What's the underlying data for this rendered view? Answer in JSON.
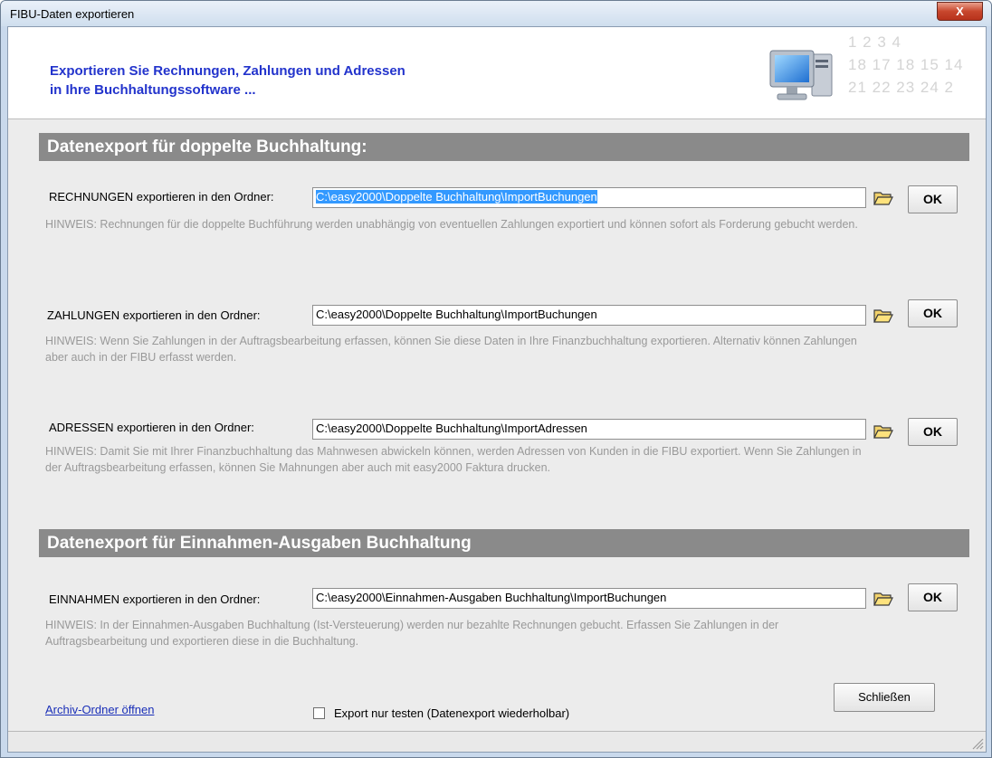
{
  "window": {
    "title": "FIBU-Daten exportieren",
    "close_glyph": "X"
  },
  "banner": {
    "line1": "Exportieren Sie Rechnungen, Zahlungen und Adressen",
    "line2": "in Ihre Buchhaltungssoftware ...",
    "calendar_row1": "1  2  3  4",
    "calendar_row2": "18 17 18 15 14",
    "calendar_row3": "21 22 23 24 2"
  },
  "sections": {
    "double": "Datenexport für doppelte Buchhaltung:",
    "income": "Datenexport für Einnahmen-Ausgaben Buchhaltung"
  },
  "rows": {
    "rechnungen": {
      "label": "RECHNUNGEN exportieren in den Ordner:",
      "path": "C:\\easy2000\\Doppelte Buchhaltung\\ImportBuchungen",
      "ok": "OK",
      "hint": "HINWEIS: Rechnungen für die doppelte Buchführung werden unabhängig von eventuellen Zahlungen exportiert und können sofort als Forderung gebucht werden."
    },
    "zahlungen": {
      "label": "ZAHLUNGEN exportieren in den Ordner:",
      "path": "C:\\easy2000\\Doppelte Buchhaltung\\ImportBuchungen",
      "ok": "OK",
      "hint": "HINWEIS: Wenn Sie Zahlungen in der Auftragsbearbeitung erfassen, können Sie diese Daten in Ihre Finanzbuchhaltung exportieren. Alternativ können Zahlungen aber auch in der FIBU erfasst werden."
    },
    "adressen": {
      "label": "ADRESSEN exportieren in den Ordner:",
      "path": "C:\\easy2000\\Doppelte Buchhaltung\\ImportAdressen",
      "ok": "OK",
      "hint": "HINWEIS: Damit Sie mit Ihrer Finanzbuchhaltung das Mahnwesen abwickeln können, werden Adressen von Kunden in die FIBU exportiert. Wenn Sie Zahlungen in der Auftragsbearbeitung erfassen, können Sie Mahnungen aber auch mit easy2000 Faktura drucken."
    },
    "einnahmen": {
      "label": "EINNAHMEN exportieren in den Ordner:",
      "path": "C:\\easy2000\\Einnahmen-Ausgaben Buchhaltung\\ImportBuchungen",
      "ok": "OK",
      "hint": "HINWEIS: In der Einnahmen-Ausgaben Buchhaltung (Ist-Versteuerung) werden nur bezahlte Rechnungen gebucht. Erfassen Sie Zahlungen in der Auftragsbearbeitung und exportieren diese in die Buchhaltung."
    }
  },
  "footer": {
    "archive_link": "Archiv-Ordner öffnen",
    "test_checkbox_label": "Export nur testen (Datenexport wiederholbar)",
    "close_button": "Schließen"
  },
  "colors": {
    "banner_text": "#2233cc",
    "section_bg": "#8a8a8a",
    "hint_text": "#999999",
    "selection": "#3399ff"
  }
}
